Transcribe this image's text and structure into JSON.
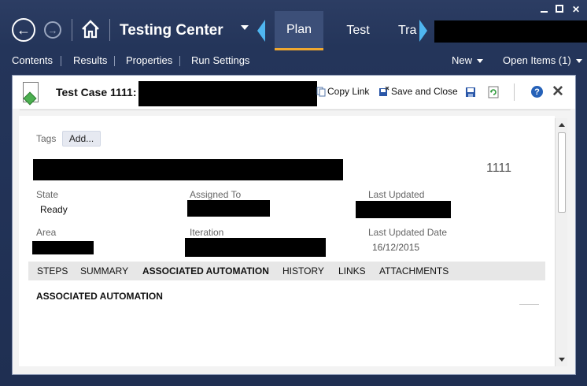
{
  "window": {
    "caption_minimize": "",
    "caption_maximize": "",
    "caption_close": "✕"
  },
  "topnav": {
    "back_glyph": "←",
    "forward_glyph": "→",
    "app_title": "Testing Center",
    "tabs": [
      {
        "label": "Plan",
        "active": true
      },
      {
        "label": "Test",
        "active": false
      },
      {
        "label": "Tra",
        "active": false
      }
    ]
  },
  "subnav": {
    "left": [
      "Contents",
      "Results",
      "Properties",
      "Run Settings"
    ],
    "new_label": "New",
    "open_items_label": "Open Items (1)"
  },
  "work_item": {
    "title_prefix": "Test Case 1111:",
    "copy_link": "Copy Link",
    "save_and_close": "Save and Close",
    "help_glyph": "?",
    "close_glyph": "✕",
    "tags_label": "Tags",
    "add_tag_label": "Add...",
    "id": "1111",
    "fields": {
      "state_label": "State",
      "state_value": "Ready",
      "assigned_to_label": "Assigned To",
      "last_updated_label": "Last Updated",
      "area_label": "Area",
      "iteration_label": "Iteration",
      "last_updated_date_label": "Last Updated Date",
      "last_updated_date_value": "16/12/2015"
    },
    "tabs": [
      {
        "label": "STEPS",
        "active": false
      },
      {
        "label": "SUMMARY",
        "active": false
      },
      {
        "label": "ASSOCIATED AUTOMATION",
        "active": true
      },
      {
        "label": "HISTORY",
        "active": false
      },
      {
        "label": "LINKS",
        "active": false
      },
      {
        "label": "ATTACHMENTS",
        "active": false
      }
    ],
    "section_title": "ASSOCIATED AUTOMATION"
  },
  "colors": {
    "chrome_bg": "#24355a",
    "active_tab_underline": "#f0a830",
    "accent_arrow": "#4fb6f0"
  }
}
